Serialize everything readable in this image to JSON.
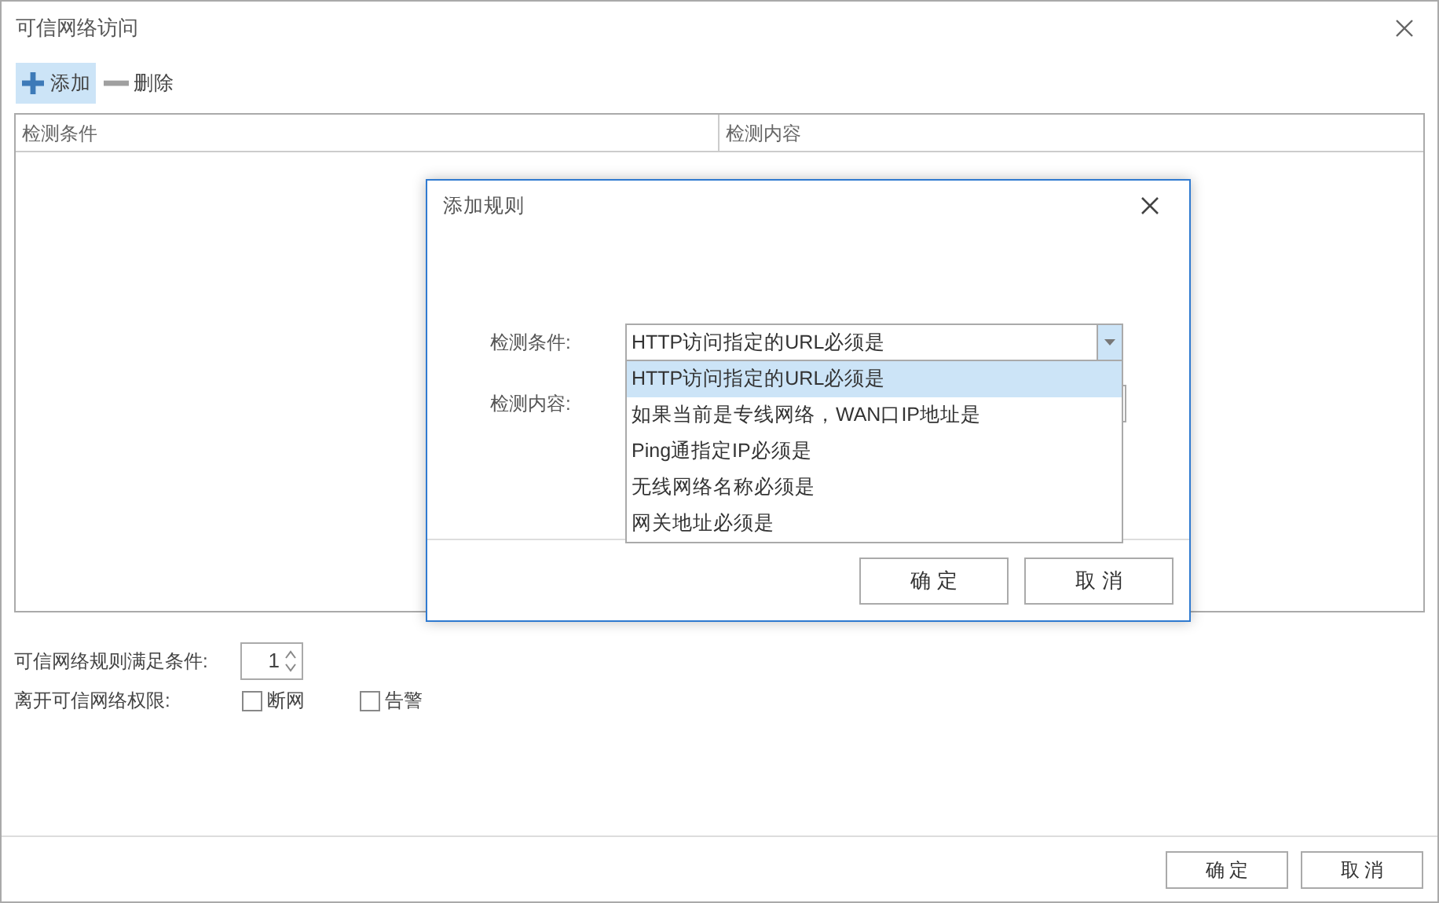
{
  "window": {
    "title": "可信网络访问"
  },
  "toolbar": [
    {
      "kind": "add",
      "label": "添加",
      "selected": true
    },
    {
      "kind": "remove",
      "label": "删除",
      "selected": false
    }
  ],
  "table": {
    "columns": [
      "检测条件",
      "检测内容"
    ]
  },
  "settings": {
    "condition_label": "可信网络规则满足条件:",
    "condition_value": "1",
    "leave_label": "离开可信网络权限:",
    "options": [
      {
        "label": "断网",
        "checked": false
      },
      {
        "label": "告警",
        "checked": false
      }
    ]
  },
  "buttons": [
    "确 定",
    "取 消"
  ],
  "dialog": {
    "title": "添加规则",
    "condition_label": "检测条件:",
    "condition_value": "HTTP访问指定的URL必须是",
    "dropdown": {
      "expanded": true,
      "options": [
        {
          "label": "HTTP访问指定的URL必须是",
          "selected": true
        },
        {
          "label": "如果当前是专线网络，WAN口IP地址是",
          "selected": false
        },
        {
          "label": "Ping通指定IP必须是",
          "selected": false
        },
        {
          "label": "无线网络名称必须是",
          "selected": false
        },
        {
          "label": "网关地址必须是",
          "selected": false
        }
      ]
    },
    "content_label": "检测内容:",
    "buttons": [
      "确 定",
      "取 消"
    ]
  }
}
